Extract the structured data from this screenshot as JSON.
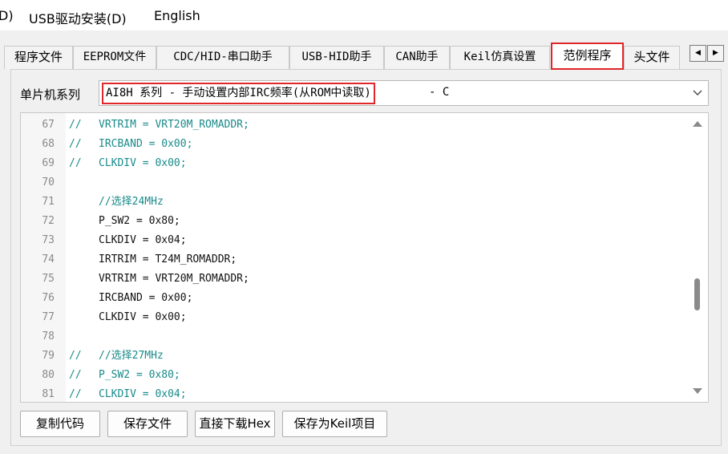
{
  "menubar": {
    "items": [
      {
        "label": "D)"
      },
      {
        "label": "USB驱动安装(D)"
      },
      {
        "label": "English"
      }
    ]
  },
  "tabs": [
    {
      "label": "程序文件"
    },
    {
      "label": "EEPROM文件"
    },
    {
      "label": "CDC/HID-串口助手"
    },
    {
      "label": "USB-HID助手"
    },
    {
      "label": "CAN助手"
    },
    {
      "label": "Keil仿真设置"
    },
    {
      "label": "范例程序",
      "active": true
    },
    {
      "label": "头文件"
    }
  ],
  "tab_scroll": {
    "left": "◀",
    "right": "▶"
  },
  "mcu": {
    "label": "单片机系列",
    "selected": "AI8H 系列 - 手动设置内部IRC频率(从ROM中读取)",
    "selected_suffix": "- C"
  },
  "code": {
    "lines": [
      {
        "n": "67",
        "prefix": "//",
        "text": "VRTRIM = VRT20M_ROMADDR;",
        "comment": true
      },
      {
        "n": "68",
        "prefix": "//",
        "text": "IRCBAND = 0x00;",
        "comment": true
      },
      {
        "n": "69",
        "prefix": "//",
        "text": "CLKDIV = 0x00;",
        "comment": true
      },
      {
        "n": "70",
        "prefix": "",
        "text": "",
        "comment": false
      },
      {
        "n": "71",
        "prefix": "",
        "text": "//选择24MHz",
        "comment": true
      },
      {
        "n": "72",
        "prefix": "",
        "text": "P_SW2 = 0x80;",
        "comment": false
      },
      {
        "n": "73",
        "prefix": "",
        "text": "CLKDIV = 0x04;",
        "comment": false
      },
      {
        "n": "74",
        "prefix": "",
        "text": "IRTRIM = T24M_ROMADDR;",
        "comment": false
      },
      {
        "n": "75",
        "prefix": "",
        "text": "VRTRIM = VRT20M_ROMADDR;",
        "comment": false
      },
      {
        "n": "76",
        "prefix": "",
        "text": "IRCBAND = 0x00;",
        "comment": false
      },
      {
        "n": "77",
        "prefix": "",
        "text": "CLKDIV = 0x00;",
        "comment": false
      },
      {
        "n": "78",
        "prefix": "",
        "text": "",
        "comment": false
      },
      {
        "n": "79",
        "prefix": "//",
        "text": "//选择27MHz",
        "comment": true
      },
      {
        "n": "80",
        "prefix": "//",
        "text": "P_SW2 = 0x80;",
        "comment": true
      },
      {
        "n": "81",
        "prefix": "//",
        "text": "CLKDIV = 0x04;",
        "comment": true
      }
    ]
  },
  "buttons": [
    {
      "label": "复制代码"
    },
    {
      "label": "保存文件"
    },
    {
      "label": "直接下载Hex"
    },
    {
      "label": "保存为Keil项目"
    }
  ],
  "colors": {
    "highlight": "#e0262b",
    "comment": "#1a8a8a"
  }
}
